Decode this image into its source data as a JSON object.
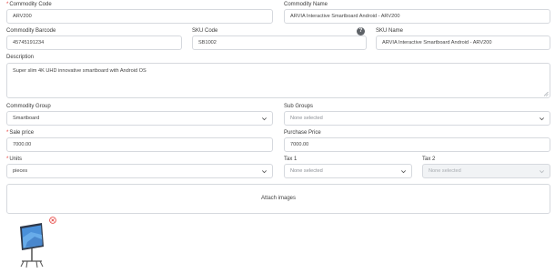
{
  "form": {
    "commodity_code": {
      "label": "Commodity Code",
      "required": true,
      "value": "ARV200"
    },
    "commodity_name": {
      "label": "Commodity Name",
      "required": false,
      "value": "ARVIA Interactive Smartboard Android - ARV200"
    },
    "commodity_barcode": {
      "label": "Commodity Barcode",
      "required": false,
      "value": "45745191234"
    },
    "sku_code": {
      "label": "SKU Code",
      "required": false,
      "value": "SB1002"
    },
    "sku_name": {
      "label": "SKU Name",
      "required": false,
      "value": "ARVIA Interactive Smartboard Android - ARV200"
    },
    "description": {
      "label": "Description",
      "required": false,
      "value": "Super slim 4K UHD innovative smartboard with Android OS"
    },
    "commodity_group": {
      "label": "Commodity Group",
      "required": false,
      "value": "Smartboard"
    },
    "sub_groups": {
      "label": "Sub Groups",
      "required": false,
      "placeholder": "None selected"
    },
    "sale_price": {
      "label": "Sale price",
      "required": true,
      "value": "7000.00"
    },
    "purchase_price": {
      "label": "Purchase Price",
      "required": false,
      "value": "7000.00"
    },
    "units": {
      "label": "Units",
      "required": true,
      "value": "pieces"
    },
    "tax1": {
      "label": "Tax 1",
      "required": false,
      "placeholder": "None selected"
    },
    "tax2": {
      "label": "Tax 2",
      "required": false,
      "placeholder": "None selected",
      "disabled": true
    },
    "attach_images": {
      "label": "Attach images"
    },
    "required_marker": "*",
    "help_glyph": "?"
  },
  "icons": {
    "help": "question-circle-icon",
    "dropdown": "chevron-down-icon",
    "remove": "close-circle-icon",
    "thumbnail": "smartboard-image"
  },
  "colors": {
    "required": "#e53935",
    "border": "#d6d9de",
    "remove": "#e53935",
    "disabled_bg": "#f1f3f5"
  }
}
